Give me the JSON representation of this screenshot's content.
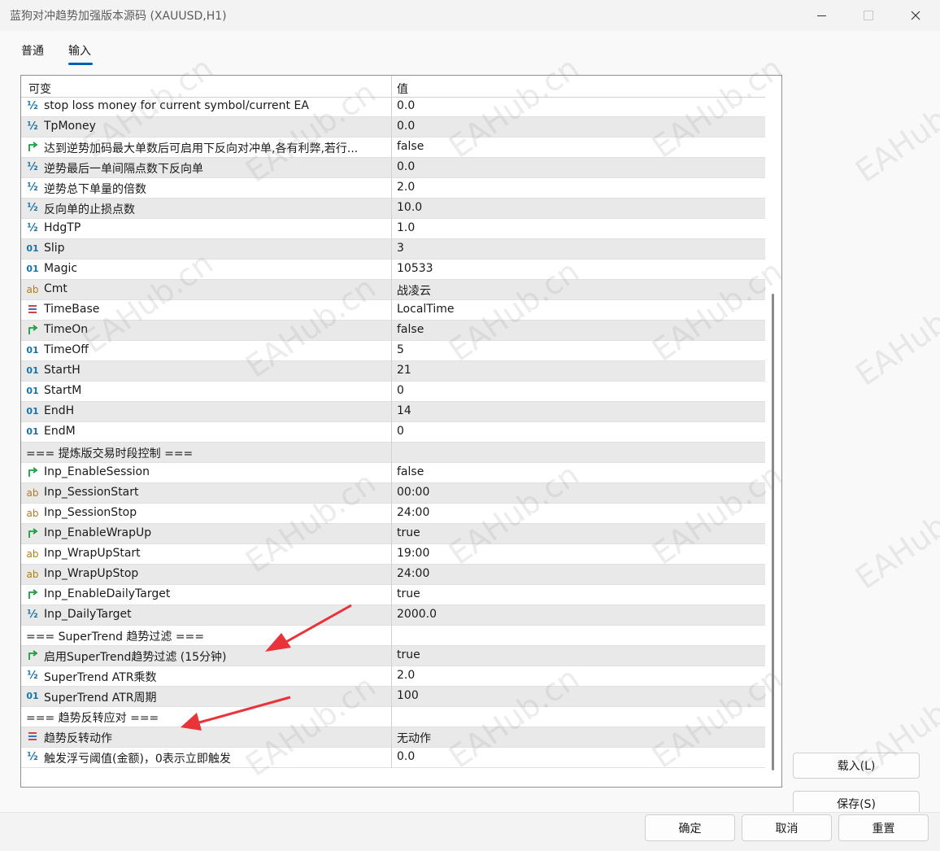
{
  "window": {
    "title": "蓝狗对冲趋势加强版本源码 (XAUUSD,H1)"
  },
  "tabs": [
    {
      "label": "普通"
    },
    {
      "label": "输入"
    }
  ],
  "table": {
    "columns": [
      "可变",
      "值"
    ],
    "rows": [
      {
        "type": "double",
        "name": "stop loss money for current symbol/current EA",
        "value": "0.0"
      },
      {
        "type": "double",
        "name": "TpMoney",
        "value": "0.0"
      },
      {
        "type": "bool",
        "name": "达到逆势加码最大单数后可启用下反向对冲单,各有利弊,若行...",
        "value": "false"
      },
      {
        "type": "double",
        "name": "逆势最后一单间隔点数下反向单",
        "value": "0.0"
      },
      {
        "type": "double",
        "name": "逆势总下单量的倍数",
        "value": "2.0"
      },
      {
        "type": "double",
        "name": "反向单的止损点数",
        "value": "10.0"
      },
      {
        "type": "double",
        "name": "HdgTP",
        "value": "1.0"
      },
      {
        "type": "int",
        "name": "Slip",
        "value": "3"
      },
      {
        "type": "int",
        "name": "Magic",
        "value": "10533"
      },
      {
        "type": "string",
        "name": "Cmt",
        "value": "战凌云"
      },
      {
        "type": "enum",
        "name": "TimeBase",
        "value": "LocalTime"
      },
      {
        "type": "bool",
        "name": "TimeOn",
        "value": "false"
      },
      {
        "type": "int",
        "name": "TimeOff",
        "value": "5"
      },
      {
        "type": "int",
        "name": "StartH",
        "value": "21"
      },
      {
        "type": "int",
        "name": "StartM",
        "value": "0"
      },
      {
        "type": "int",
        "name": "EndH",
        "value": "14"
      },
      {
        "type": "int",
        "name": "EndM",
        "value": "0"
      },
      {
        "type": "section",
        "name": "=== 提炼版交易时段控制 ===",
        "value": ""
      },
      {
        "type": "bool",
        "name": "Inp_EnableSession",
        "value": "false"
      },
      {
        "type": "string",
        "name": "Inp_SessionStart",
        "value": "00:00"
      },
      {
        "type": "string",
        "name": "Inp_SessionStop",
        "value": "24:00"
      },
      {
        "type": "bool",
        "name": "Inp_EnableWrapUp",
        "value": "true"
      },
      {
        "type": "string",
        "name": "Inp_WrapUpStart",
        "value": "19:00"
      },
      {
        "type": "string",
        "name": "Inp_WrapUpStop",
        "value": "24:00"
      },
      {
        "type": "bool",
        "name": "Inp_EnableDailyTarget",
        "value": "true"
      },
      {
        "type": "double",
        "name": "Inp_DailyTarget",
        "value": "2000.0"
      },
      {
        "type": "section",
        "name": "=== SuperTrend 趋势过滤 ===",
        "value": ""
      },
      {
        "type": "bool",
        "name": "启用SuperTrend趋势过滤 (15分钟)",
        "value": "true"
      },
      {
        "type": "double",
        "name": "SuperTrend ATR乘数",
        "value": "2.0"
      },
      {
        "type": "int",
        "name": "SuperTrend ATR周期",
        "value": "100"
      },
      {
        "type": "section",
        "name": "=== 趋势反转应对 ===",
        "value": ""
      },
      {
        "type": "enum",
        "name": "趋势反转动作",
        "value": "无动作"
      },
      {
        "type": "double",
        "name": "触发浮亏阈值(金额)，0表示立即触发",
        "value": "0.0"
      }
    ]
  },
  "icons": {
    "double": "½",
    "int": "01",
    "string": "ab"
  },
  "side_buttons": {
    "load": "载入(L)",
    "save": "保存(S)"
  },
  "footer_buttons": {
    "ok": "确定",
    "cancel": "取消",
    "reset": "重置"
  },
  "watermark": "EAHub.cn",
  "colors": {
    "accent": "#005fb8",
    "annotation_arrow": "#e8333a"
  }
}
